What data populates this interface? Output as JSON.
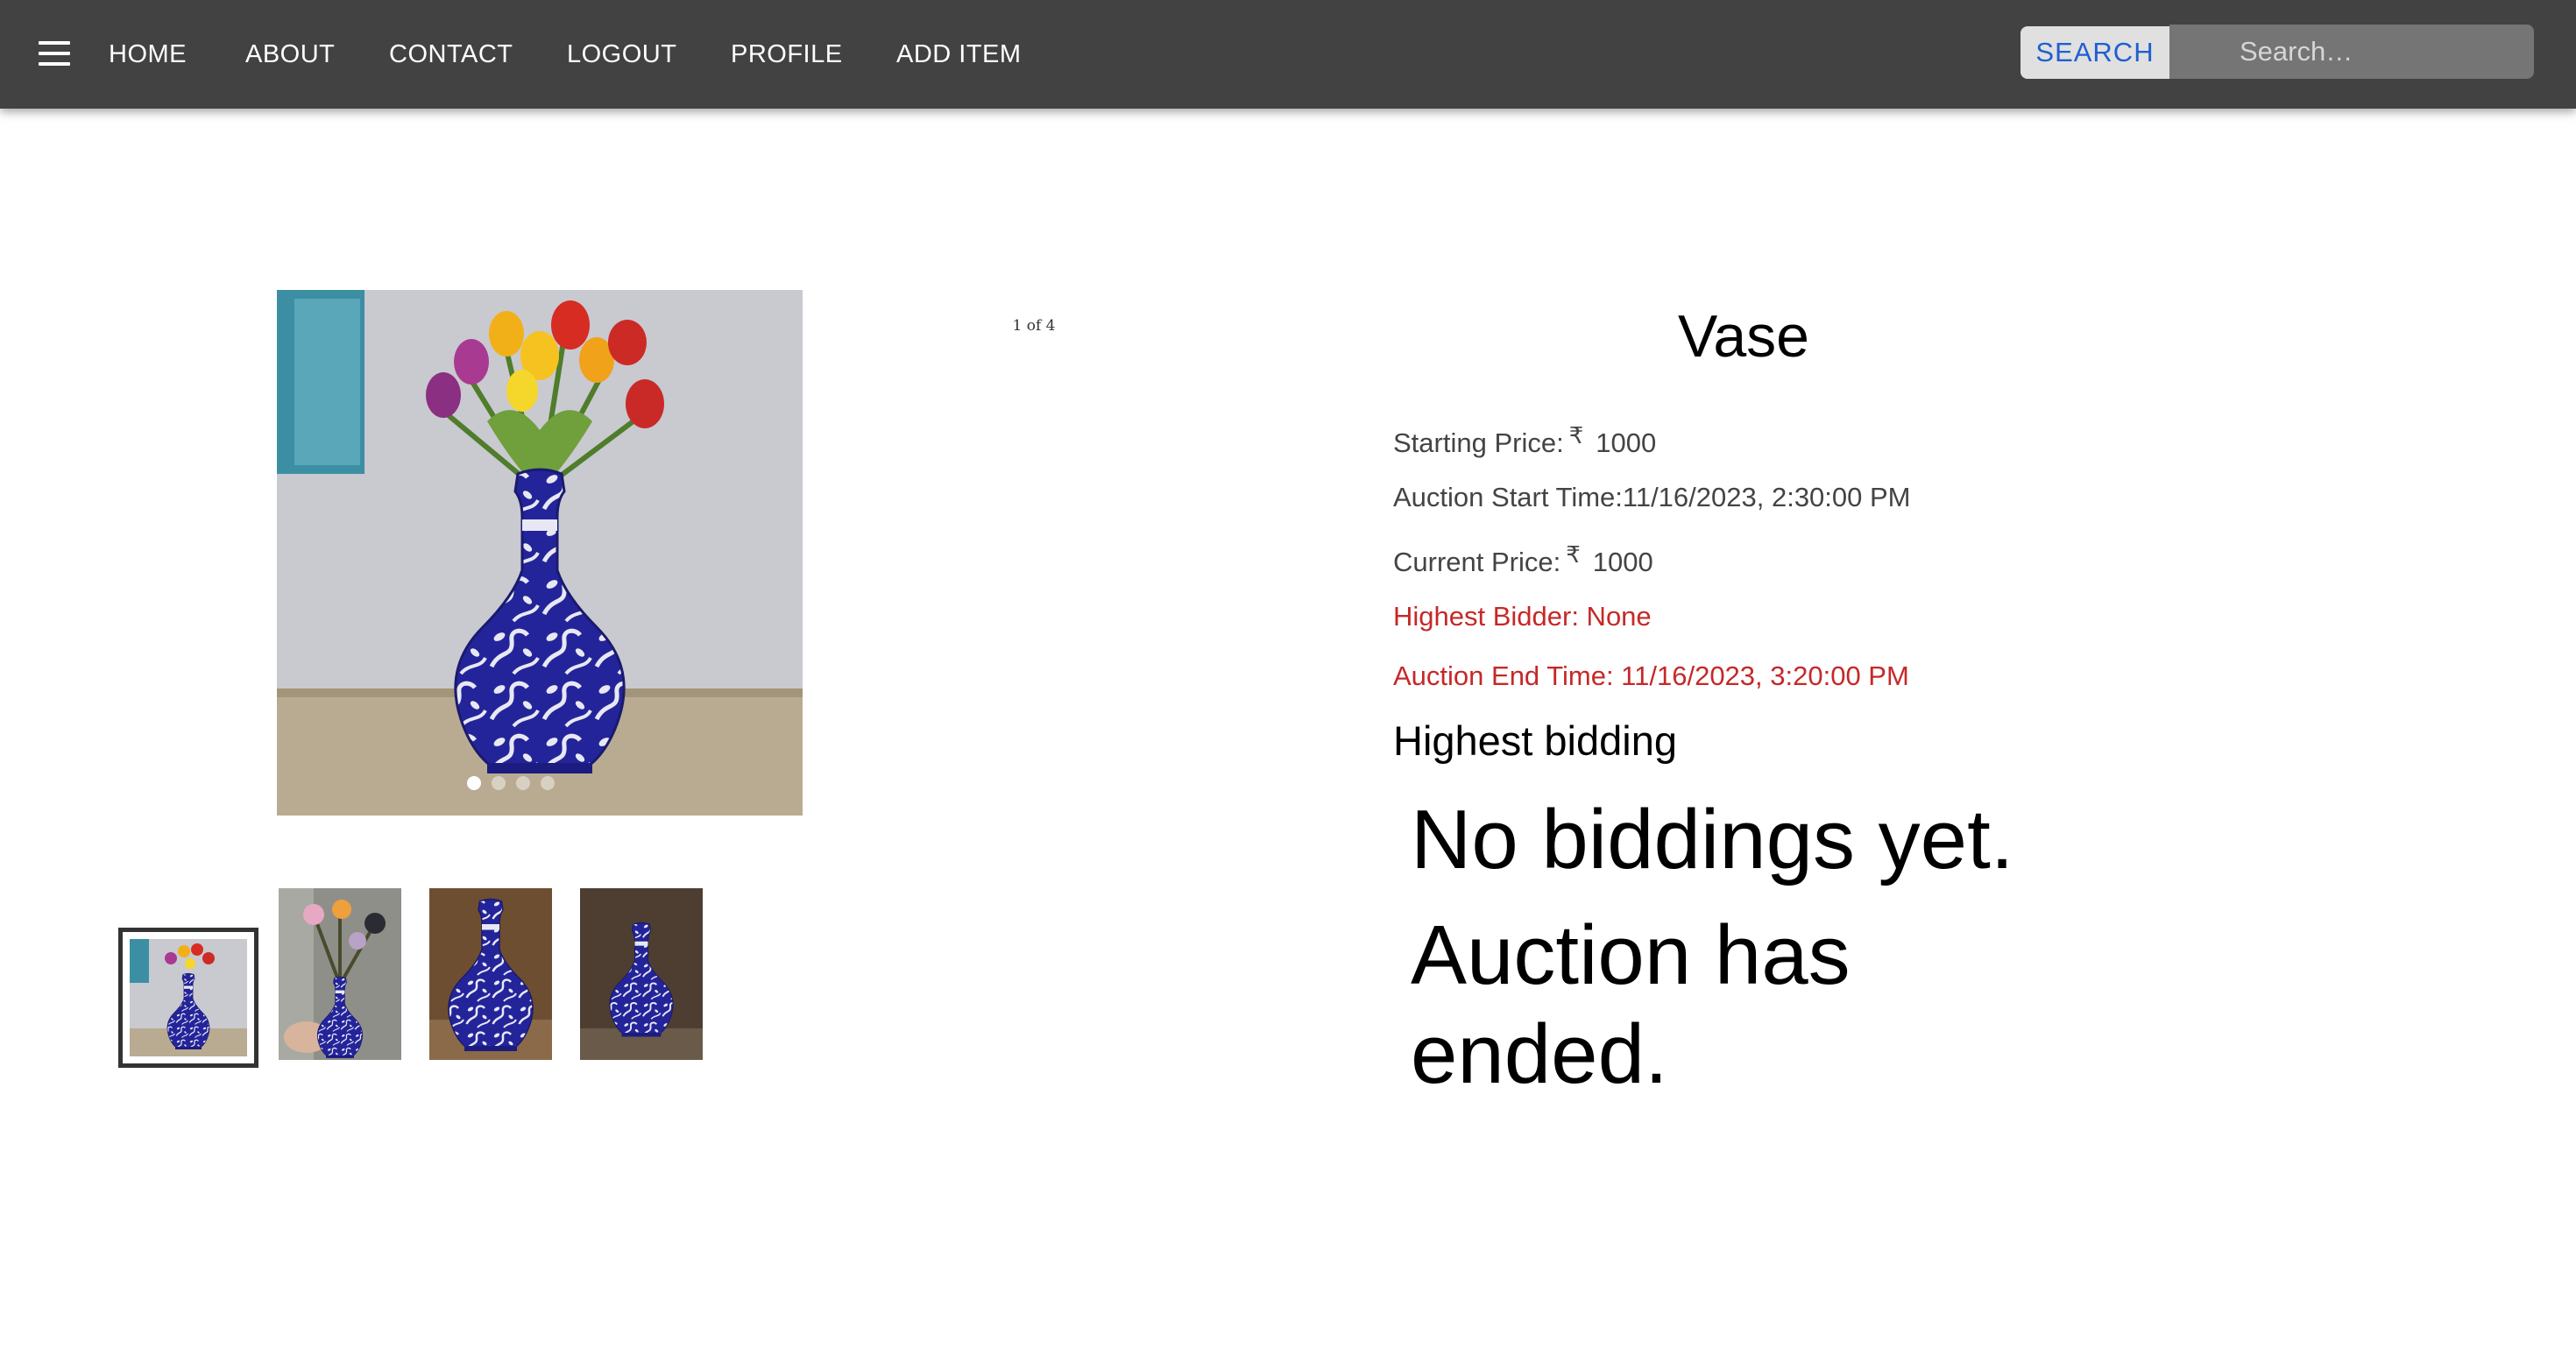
{
  "nav": {
    "menu_icon": "hamburger-menu-icon",
    "links": [
      "HOME",
      "ABOUT",
      "CONTACT",
      "LOGOUT",
      "PROFILE",
      "ADD ITEM"
    ],
    "search_button": "SEARCH",
    "search_placeholder": "Search…"
  },
  "gallery": {
    "counter": "1 of 4",
    "image_count": 4,
    "current_index": 1
  },
  "item": {
    "title": "Vase",
    "starting_price_label": "Starting Price:",
    "currency_symbol": "₹",
    "starting_price": "1000",
    "auction_start_label": "Auction Start Time:",
    "auction_start": "11/16/2023, 2:30:00 PM",
    "current_price_label": "Current Price:",
    "current_price": "1000",
    "highest_bidder": "Highest Bidder: None",
    "auction_end": "Auction End Time: 11/16/2023, 3:20:00 PM"
  },
  "bidding": {
    "heading": "Highest bidding",
    "empty_message": "No biddings yet.",
    "status_message": "Auction has ended."
  },
  "colors": {
    "navbar": "#424242",
    "search_accent": "#1f5fd1",
    "alert": "#c62828"
  }
}
